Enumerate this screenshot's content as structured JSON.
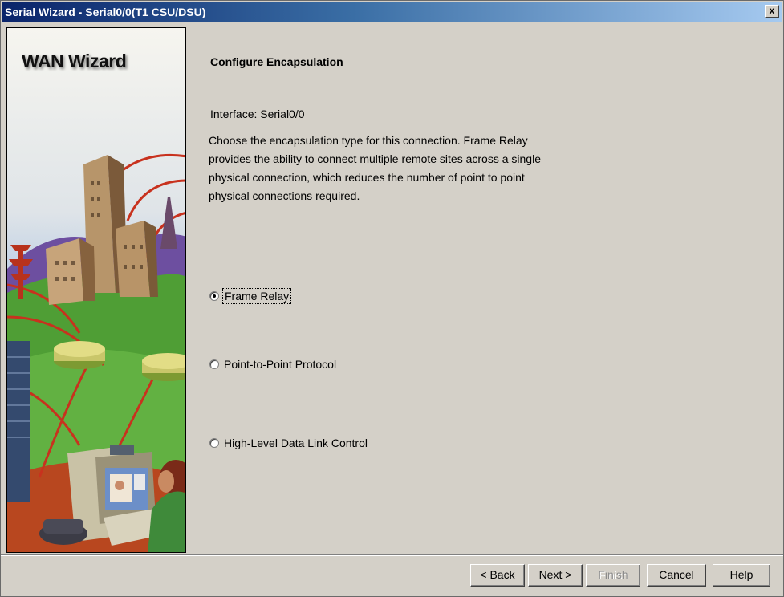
{
  "window": {
    "title": "Serial Wizard - Serial0/0(T1 CSU/DSU)",
    "close_label": "x"
  },
  "sidebar": {
    "title": "WAN Wizard"
  },
  "main": {
    "heading": "Configure Encapsulation",
    "interface_label": "Interface: Serial0/0",
    "description": "Choose the encapsulation type for this connection. Frame Relay provides the ability to connect multiple remote sites across a single physical connection, which reduces the number of point to point physical connections required.",
    "options": [
      {
        "label": "Frame Relay",
        "selected": true
      },
      {
        "label": "Point-to-Point Protocol",
        "selected": false
      },
      {
        "label": "High-Level Data Link Control",
        "selected": false
      }
    ]
  },
  "buttons": {
    "back": "< Back",
    "next": "Next >",
    "finish": "Finish",
    "cancel": "Cancel",
    "help": "Help"
  },
  "colors": {
    "titlebar_start": "#0a246a",
    "titlebar_end": "#a6caf0",
    "dialog_bg": "#d4d0c8"
  }
}
